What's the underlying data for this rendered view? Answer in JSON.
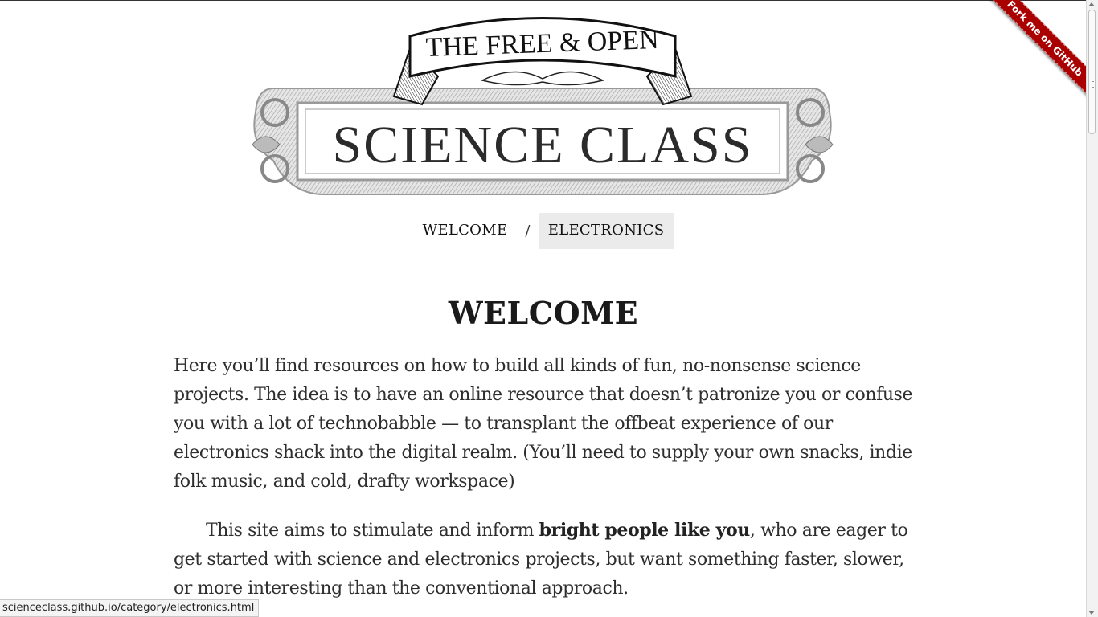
{
  "logo": {
    "banner_text": "THE FREE & OPEN",
    "title_text": "SCIENCE CLASS"
  },
  "nav": {
    "items": [
      {
        "label": "WELCOME"
      },
      {
        "label": "ELECTRONICS"
      }
    ],
    "separator": "/"
  },
  "main": {
    "heading": "WELCOME",
    "paragraph1": "Here you’ll find resources on how to build all kinds of fun, no-nonsense science projects. The idea is to have an online resource that doesn’t patronize you or confuse you with a lot of technobabble — to transplant the offbeat experience of our electronics shack into the digital realm. (You’ll need to supply your own snacks, indie folk music, and cold, drafty workspace)",
    "paragraph2_before": "This site aims to stimulate and inform ",
    "paragraph2_bold": "bright people like you",
    "paragraph2_after": ", who are eager to get started with science and electronics projects, but want something faster, slower, or more interesting than the conventional approach."
  },
  "ribbon": {
    "label": "Fork me on GitHub",
    "color": "#aa0000"
  },
  "status_bar": {
    "url": "scienceclass.github.io/category/electronics.html"
  }
}
